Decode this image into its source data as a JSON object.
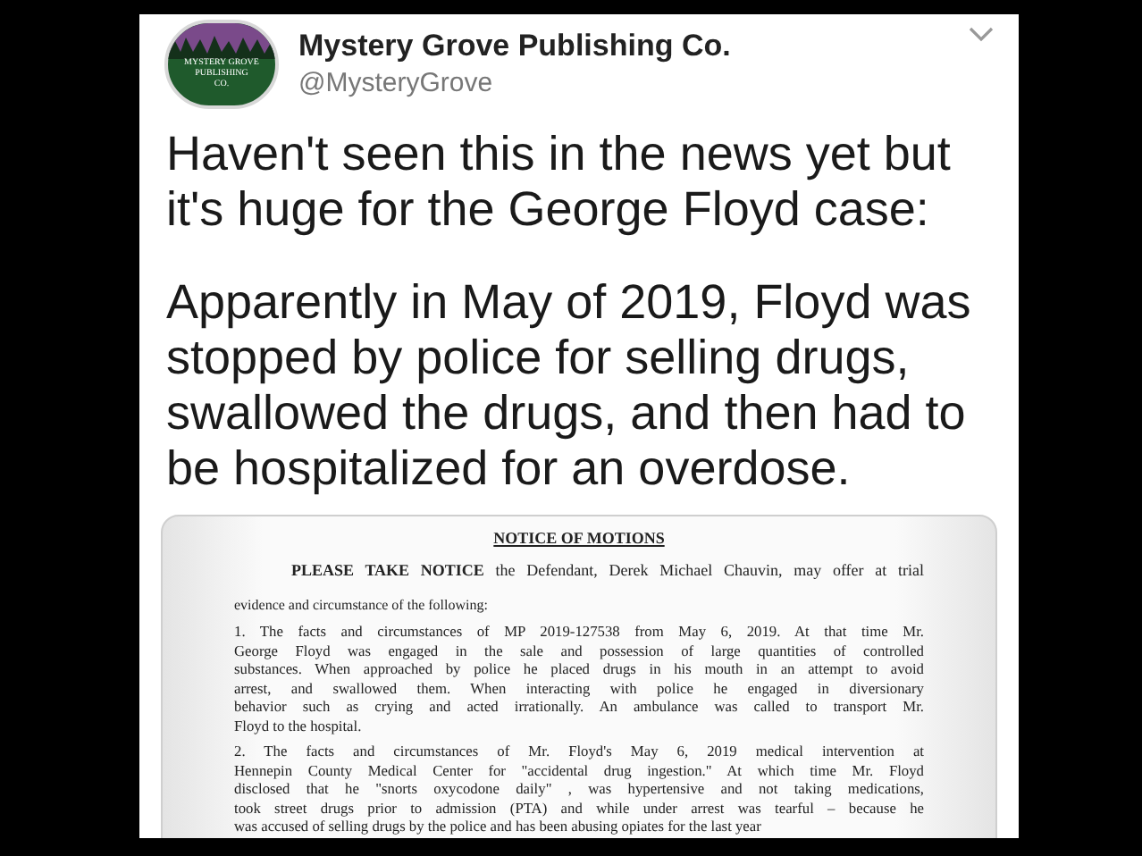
{
  "tweet": {
    "author": {
      "name": "Mystery Grove Publishing Co.",
      "handle": "@MysteryGrove",
      "logo_text": [
        "MYSTERY GROVE",
        "PUBLISHING",
        "CO."
      ]
    },
    "paragraphs": [
      "Haven't seen this in the news yet but it's huge for the George Floyd case:",
      "Apparently in May of 2019, Floyd was stopped by police for selling drugs, swallowed the drugs, and then had to be hospitalized for an overdose."
    ],
    "document": {
      "title": "NOTICE OF MOTIONS",
      "intro": [
        "**PLEASE TAKE NOTICE** the Defendant, Derek Michael Chauvin, may offer at trial",
        "evidence and circumstance of the following:"
      ],
      "items": [
        [
          "1. The facts and circumstances of MP 2019-127538 from May 6, 2019. At that time Mr.",
          "George Floyd was engaged in the sale and possession of large quantities of controlled",
          "substances. When approached by police he placed drugs in his mouth in an attempt to avoid",
          "arrest, and swallowed them. When interacting with police he engaged in diversionary",
          "behavior such as crying and acted irrationally. An ambulance was called to transport Mr.",
          "Floyd to the hospital."
        ],
        [
          "2. The facts and circumstances of Mr. Floyd's May 6, 2019 medical intervention at",
          "Hennepin County Medical Center for \"accidental drug ingestion.\" At which time Mr. Floyd",
          "disclosed that he \"snorts oxycodone daily\" , was hypertensive and not taking medications,",
          "took street drugs prior to admission (PTA) and while under arrest was tearful – because he",
          "was accused of selling drugs by the police and has been abusing opiates for the last year"
        ]
      ]
    }
  }
}
